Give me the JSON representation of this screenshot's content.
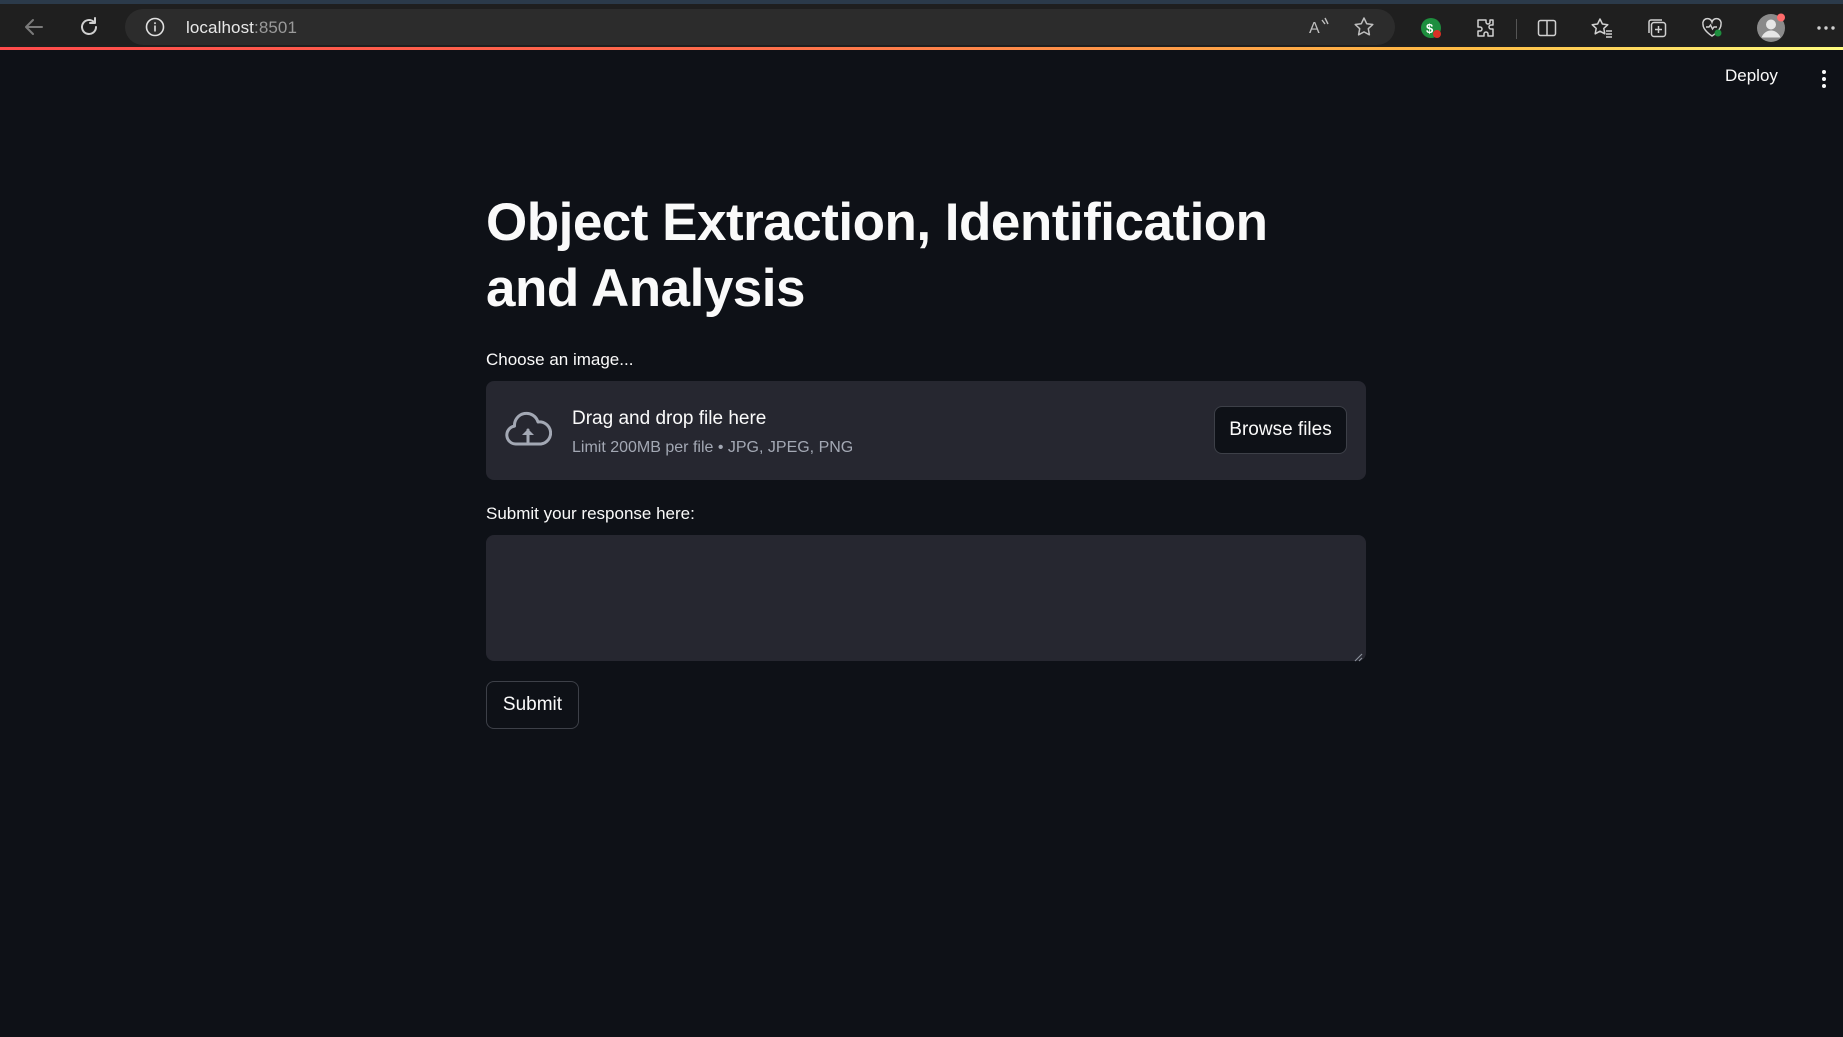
{
  "browser": {
    "url_host": "localhost",
    "url_port": ":8501",
    "icons": [
      "back-icon",
      "refresh-icon",
      "info-icon",
      "read-aloud-icon",
      "favorite-star-icon",
      "extension-badge-icon",
      "extensions-puzzle-icon",
      "split-screen-icon",
      "favorites-icon",
      "collections-icon",
      "browser-essentials-icon",
      "profile-avatar-icon",
      "more-menu-icon"
    ],
    "accent_gradient": [
      "#ff4b4b",
      "#ffbd45",
      "#fffd80"
    ]
  },
  "header": {
    "deploy_label": "Deploy"
  },
  "main": {
    "title": "Object Extraction, Identification and Analysis",
    "uploader": {
      "label": "Choose an image...",
      "drop_title": "Drag and drop file here",
      "drop_subtitle": "Limit 200MB per file • JPG, JPEG, PNG",
      "browse_label": "Browse files"
    },
    "response": {
      "label": "Submit your response here:",
      "value": "",
      "placeholder": ""
    },
    "submit_label": "Submit"
  },
  "colors": {
    "background": "#0e1117",
    "widget_bg": "#262730",
    "text": "#fafafa",
    "muted_text": "#a3a8b4"
  }
}
